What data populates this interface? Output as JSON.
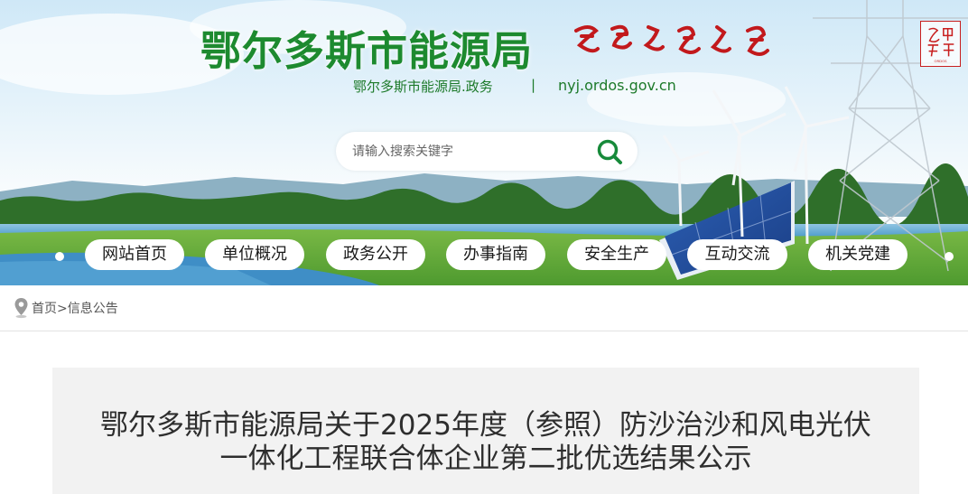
{
  "header": {
    "site_title": "鄂尔多斯市能源局",
    "subtitle_name": "鄂尔多斯市能源局.政务",
    "separator": "|",
    "domain": "nyj.ordos.gov.cn",
    "logo_text": "鄂尔多斯"
  },
  "search": {
    "placeholder": "请输入搜索关键字",
    "icon": "search-icon"
  },
  "nav": {
    "items": [
      {
        "label": "网站首页"
      },
      {
        "label": "单位概况"
      },
      {
        "label": "政务公开"
      },
      {
        "label": "办事指南"
      },
      {
        "label": "安全生产"
      },
      {
        "label": "互动交流"
      },
      {
        "label": "机关党建"
      }
    ]
  },
  "breadcrumb": {
    "icon": "location-pin-icon",
    "home": "首页",
    "sep": ">",
    "current": "信息公告"
  },
  "article": {
    "title_line1": "鄂尔多斯市能源局关于2025年度（参照）防沙治沙和风电光伏",
    "title_line2": "一体化工程联合体企业第二批优选结果公示"
  },
  "colors": {
    "brand_green": "#1d8a2f",
    "search_icon_green": "#178a3a",
    "logo_red": "#c81e1e",
    "title_bg": "#f2f2f2"
  }
}
